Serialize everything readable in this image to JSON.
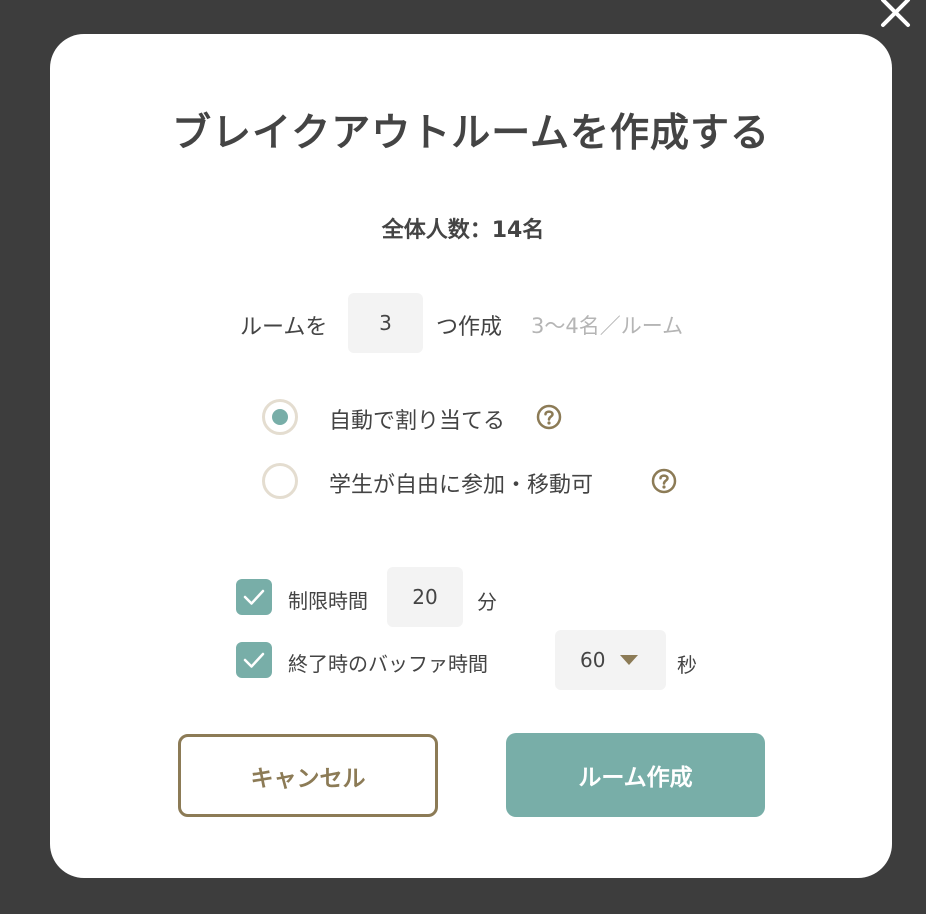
{
  "dialog": {
    "title": "ブレイクアウトルームを作成する",
    "total_participants": "全体人数：14名"
  },
  "rooms": {
    "prefix": "ルームを",
    "count": "3",
    "suffix": "つ作成",
    "hint": "3〜4名／ルーム"
  },
  "assignment": {
    "options": [
      {
        "label": "自動で割り当てる",
        "selected": true,
        "icon": "help-icon"
      },
      {
        "label": "学生が自由に参加・移動可",
        "selected": false,
        "icon": "help-icon"
      }
    ]
  },
  "time_limit": {
    "label": "制限時間",
    "checked": true,
    "value": "20",
    "unit": "分"
  },
  "buffer": {
    "label": "終了時のバッファ時間",
    "checked": true,
    "value": "60",
    "unit": "秒"
  },
  "buttons": {
    "cancel": "キャンセル",
    "create": "ルーム作成"
  },
  "colors": {
    "accent": "#78aea8",
    "brown": "#8c7b56",
    "overlay": "#3d3d3d",
    "text": "#444444",
    "muted": "#b5b5b5"
  }
}
